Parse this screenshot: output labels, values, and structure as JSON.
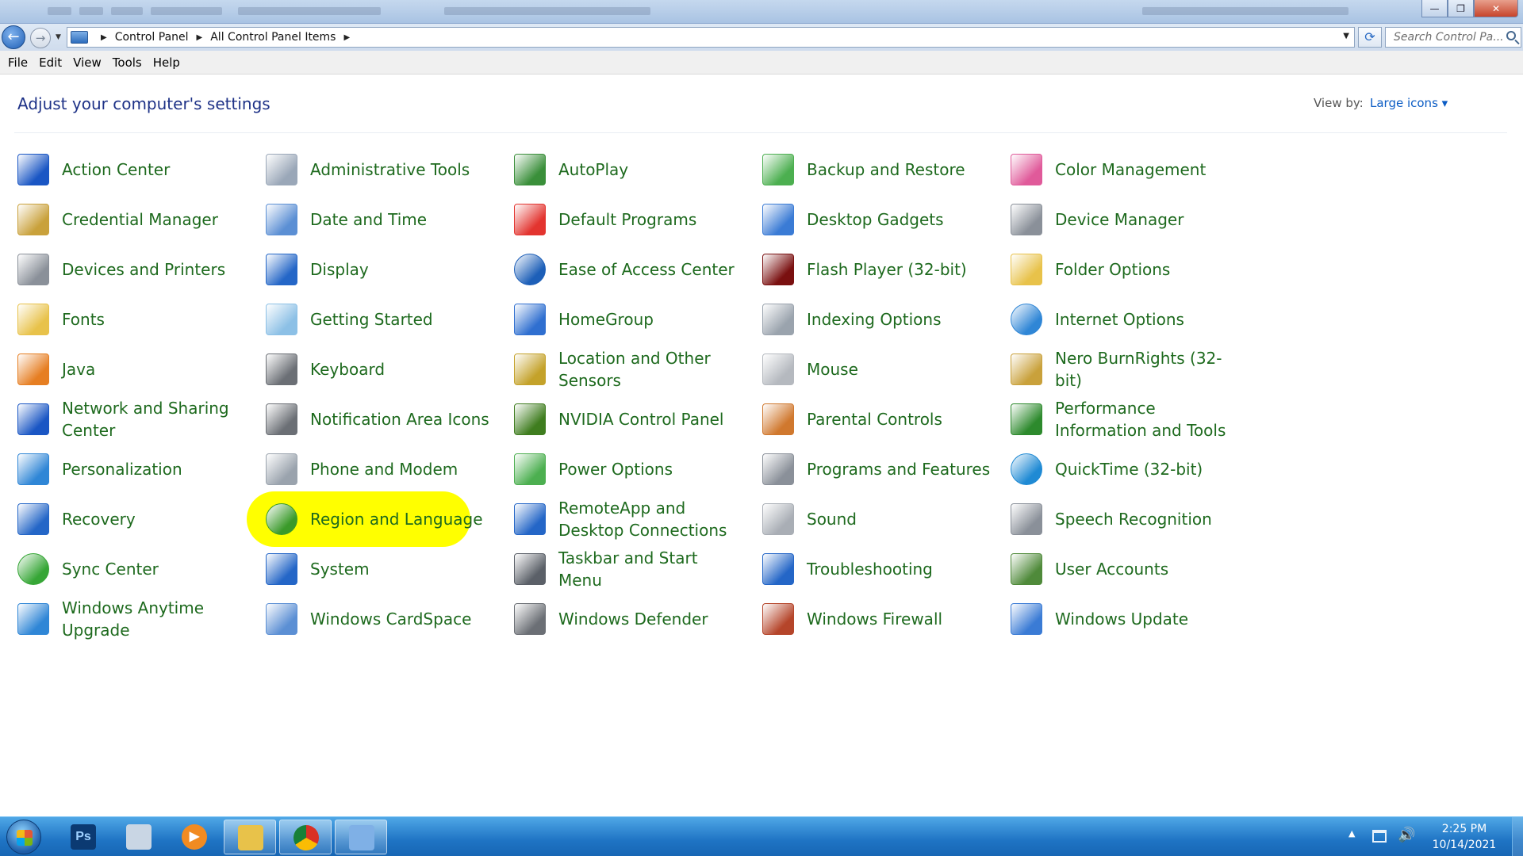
{
  "window": {
    "buttons": {
      "minimize": "—",
      "maximize": "❐",
      "close": "✕"
    }
  },
  "nav": {
    "back_icon": "←",
    "forward_icon": "→",
    "breadcrumbs": [
      "Control Panel",
      "All Control Panel Items"
    ],
    "search_placeholder": "Search Control Pa...",
    "refresh_icon": "⟳"
  },
  "menu": [
    "File",
    "Edit",
    "View",
    "Tools",
    "Help"
  ],
  "header": {
    "title": "Adjust your computer's settings",
    "view_by_label": "View by:",
    "view_by_value": "Large icons ▾"
  },
  "items": [
    {
      "label": "Action Center",
      "icon": "flag-icon",
      "color": "#1a56c4"
    },
    {
      "label": "Administrative Tools",
      "icon": "tools-icon",
      "color": "#9aa7b8"
    },
    {
      "label": "AutoPlay",
      "icon": "autoplay-icon",
      "color": "#3a8f3a"
    },
    {
      "label": "Backup and Restore",
      "icon": "backup-icon",
      "color": "#4caf50"
    },
    {
      "label": "Color Management",
      "icon": "color-icon",
      "color": "#e05a9a"
    },
    {
      "label": "Credential Manager",
      "icon": "vault-icon",
      "color": "#c9a13b"
    },
    {
      "label": "Date and Time",
      "icon": "calendar-icon",
      "color": "#5b8fd4"
    },
    {
      "label": "Default Programs",
      "icon": "default-programs-icon",
      "color": "#e3342f"
    },
    {
      "label": "Desktop Gadgets",
      "icon": "gadgets-icon",
      "color": "#3a7bd5"
    },
    {
      "label": "Device Manager",
      "icon": "device-manager-icon",
      "color": "#8a9099"
    },
    {
      "label": "Devices and Printers",
      "icon": "printer-icon",
      "color": "#8a9099"
    },
    {
      "label": "Display",
      "icon": "display-icon",
      "color": "#2466c7"
    },
    {
      "label": "Ease of Access Center",
      "icon": "ease-access-icon",
      "color": "#1d5fb8"
    },
    {
      "label": "Flash Player (32-bit)",
      "icon": "flash-icon",
      "color": "#7a1010"
    },
    {
      "label": "Folder Options",
      "icon": "folder-icon",
      "color": "#e8c24a"
    },
    {
      "label": "Fonts",
      "icon": "fonts-icon",
      "color": "#e8c24a"
    },
    {
      "label": "Getting Started",
      "icon": "getting-started-icon",
      "color": "#8cc0e6"
    },
    {
      "label": "HomeGroup",
      "icon": "homegroup-icon",
      "color": "#2f6fd0"
    },
    {
      "label": "Indexing Options",
      "icon": "indexing-icon",
      "color": "#9aa3ad"
    },
    {
      "label": "Internet Options",
      "icon": "globe-icon",
      "color": "#2f86d6"
    },
    {
      "label": "Java",
      "icon": "java-icon",
      "color": "#e67e22"
    },
    {
      "label": "Keyboard",
      "icon": "keyboard-icon",
      "color": "#6b6f75"
    },
    {
      "label": "Location and Other Sensors",
      "icon": "sensor-icon",
      "color": "#c4a22a"
    },
    {
      "label": "Mouse",
      "icon": "mouse-icon",
      "color": "#b5b9bf"
    },
    {
      "label": "Nero BurnRights (32-bit)",
      "icon": "nero-icon",
      "color": "#c9a13b"
    },
    {
      "label": "Network and Sharing Center",
      "icon": "network-icon",
      "color": "#1a56c4"
    },
    {
      "label": "Notification Area Icons",
      "icon": "notification-icon",
      "color": "#6b6f75"
    },
    {
      "label": "NVIDIA Control Panel",
      "icon": "nvidia-icon",
      "color": "#3f7d1f"
    },
    {
      "label": "Parental Controls",
      "icon": "parental-icon",
      "color": "#d0782e"
    },
    {
      "label": "Performance Information and Tools",
      "icon": "performance-icon",
      "color": "#2d8a2d"
    },
    {
      "label": "Personalization",
      "icon": "personalization-icon",
      "color": "#2f86d6"
    },
    {
      "label": "Phone and Modem",
      "icon": "phone-icon",
      "color": "#9aa3ad"
    },
    {
      "label": "Power Options",
      "icon": "power-icon",
      "color": "#4caf50"
    },
    {
      "label": "Programs and Features",
      "icon": "programs-icon",
      "color": "#8a9099"
    },
    {
      "label": "QuickTime (32-bit)",
      "icon": "quicktime-icon",
      "color": "#1f8ad4"
    },
    {
      "label": "Recovery",
      "icon": "recovery-icon",
      "color": "#2466c7"
    },
    {
      "label": "Region and Language",
      "icon": "region-globe-icon",
      "color": "#3a9a2a",
      "highlight": true
    },
    {
      "label": "RemoteApp and Desktop Connections",
      "icon": "remote-icon",
      "color": "#2466c7"
    },
    {
      "label": "Sound",
      "icon": "speaker-icon",
      "color": "#a9aeb5"
    },
    {
      "label": "Speech Recognition",
      "icon": "microphone-icon",
      "color": "#8a9099"
    },
    {
      "label": "Sync Center",
      "icon": "sync-icon",
      "color": "#36a636"
    },
    {
      "label": "System",
      "icon": "system-icon",
      "color": "#2466c7"
    },
    {
      "label": "Taskbar and Start Menu",
      "icon": "taskbar-icon",
      "color": "#5b6068"
    },
    {
      "label": "Troubleshooting",
      "icon": "troubleshoot-icon",
      "color": "#2466c7"
    },
    {
      "label": "User Accounts",
      "icon": "users-icon",
      "color": "#4f8a3a"
    },
    {
      "label": "Windows Anytime Upgrade",
      "icon": "windows-logo-icon",
      "color": "#2f86d6"
    },
    {
      "label": "Windows CardSpace",
      "icon": "cardspace-icon",
      "color": "#5b8fd4"
    },
    {
      "label": "Windows Defender",
      "icon": "defender-icon",
      "color": "#6b6f75"
    },
    {
      "label": "Windows Firewall",
      "icon": "firewall-icon",
      "color": "#b5452a"
    },
    {
      "label": "Windows Update",
      "icon": "update-icon",
      "color": "#3a7bd5"
    }
  ],
  "taskbar": {
    "apps": [
      {
        "name": "photoshop",
        "icon": "photoshop-icon",
        "color": "#0b3a72",
        "text": "Ps"
      },
      {
        "name": "snipping",
        "icon": "snipping-icon",
        "color": "#c9d6e4",
        "text": ""
      },
      {
        "name": "media-player",
        "icon": "media-player-icon",
        "color": "#f18b22",
        "text": "▶"
      },
      {
        "name": "explorer",
        "icon": "folder-icon",
        "color": "#e8c24a",
        "text": ""
      },
      {
        "name": "chrome",
        "icon": "chrome-icon",
        "color": "#d93025",
        "text": ""
      },
      {
        "name": "control-panel",
        "icon": "control-panel-icon",
        "color": "#7fb0e6",
        "text": ""
      }
    ],
    "time": "2:25 PM",
    "date": "10/14/2021"
  }
}
